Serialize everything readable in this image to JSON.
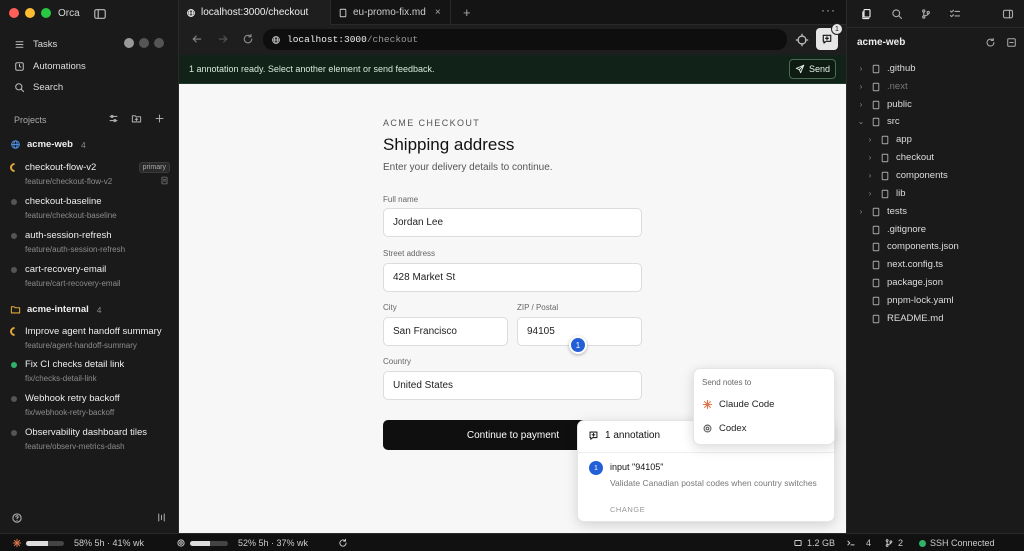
{
  "app": {
    "name": "Orca"
  },
  "sidebar": {
    "nav": [
      {
        "label": "Tasks"
      },
      {
        "label": "Automations"
      },
      {
        "label": "Search"
      }
    ],
    "projects_label": "Projects",
    "repos": [
      {
        "name": "acme-web",
        "count": "4",
        "worktrees": [
          {
            "name": "checkout-flow-v2",
            "branch": "feature/checkout-flow-v2",
            "badge": "primary",
            "status": "running"
          },
          {
            "name": "checkout-baseline",
            "branch": "feature/checkout-baseline",
            "status": "idle"
          },
          {
            "name": "auth-session-refresh",
            "branch": "feature/auth-session-refresh",
            "status": "idle"
          },
          {
            "name": "cart-recovery-email",
            "branch": "feature/cart-recovery-email",
            "status": "idle"
          }
        ]
      },
      {
        "name": "acme-internal",
        "count": "4",
        "worktrees": [
          {
            "name": "Improve agent handoff summary",
            "branch": "feature/agent-handoff-summary",
            "status": "running"
          },
          {
            "name": "Fix CI checks detail link",
            "branch": "fix/checks-detail-link",
            "status": "done"
          },
          {
            "name": "Webhook retry backoff",
            "branch": "fix/webhook-retry-backoff",
            "status": "idle"
          },
          {
            "name": "Observability dashboard tiles",
            "branch": "feature/observ-metrics-dash",
            "status": "idle"
          }
        ]
      }
    ],
    "bottom_right": "⌘"
  },
  "tabs": [
    {
      "label": "localhost:3000/checkout",
      "active": true
    },
    {
      "label": "eu-promo-fix.md",
      "active": false
    }
  ],
  "urlbar": {
    "host": "localhost:3000",
    "path": " /checkout",
    "annotation_count": "1"
  },
  "banner": {
    "message": "1 annotation ready. Select another element or send feedback.",
    "send_label": "Send"
  },
  "checkout": {
    "eyebrow": "ACME CHECKOUT",
    "title": "Shipping address",
    "subtitle": "Enter your delivery details to continue.",
    "full_name_label": "Full name",
    "full_name": "Jordan Lee",
    "street_label": "Street address",
    "street": "428 Market St",
    "city_label": "City",
    "city": "San Francisco",
    "zip_label": "ZIP / Postal",
    "zip": "94105",
    "country_label": "Country",
    "country": "United States",
    "submit": "Continue to payment",
    "marker": "1"
  },
  "send_notes": {
    "title": "Send notes to",
    "options": [
      "Claude Code",
      "Codex"
    ]
  },
  "annotation_panel": {
    "header": "1 annotation",
    "number": "1",
    "target": "input \"94105\"",
    "text": "Validate Canadian postal codes when country switches",
    "change": "CHANGE"
  },
  "explorer": {
    "repo": "acme-web",
    "items": [
      {
        "label": ".github",
        "type": "folder",
        "depth": 0
      },
      {
        "label": ".next",
        "type": "folder",
        "depth": 0,
        "dim": true
      },
      {
        "label": "public",
        "type": "folder",
        "depth": 0
      },
      {
        "label": "src",
        "type": "folder",
        "depth": 0,
        "open": true
      },
      {
        "label": "app",
        "type": "folder",
        "depth": 1
      },
      {
        "label": "checkout",
        "type": "folder",
        "depth": 1
      },
      {
        "label": "components",
        "type": "folder",
        "depth": 1
      },
      {
        "label": "lib",
        "type": "folder",
        "depth": 1
      },
      {
        "label": "tests",
        "type": "folder",
        "depth": 0
      },
      {
        "label": ".gitignore",
        "type": "file",
        "depth": 0
      },
      {
        "label": "components.json",
        "type": "file",
        "depth": 0
      },
      {
        "label": "next.config.ts",
        "type": "file",
        "depth": 0
      },
      {
        "label": "package.json",
        "type": "file",
        "depth": 0
      },
      {
        "label": "pnpm-lock.yaml",
        "type": "file",
        "depth": 0
      },
      {
        "label": "README.md",
        "type": "file",
        "depth": 0
      }
    ]
  },
  "statusbar": {
    "usage1": "58% 5h · 41% wk",
    "usage1_fill": 0.58,
    "usage2": "52% 5h · 37% wk",
    "usage2_fill": 0.52,
    "memory": "1.2 GB",
    "ports": "4",
    "branches": "2",
    "connection": "SSH Connected"
  },
  "colors": {
    "accent": "#2360d8",
    "banner": "#112218",
    "connected": "#2fb36a",
    "running": "#e0a83a"
  }
}
